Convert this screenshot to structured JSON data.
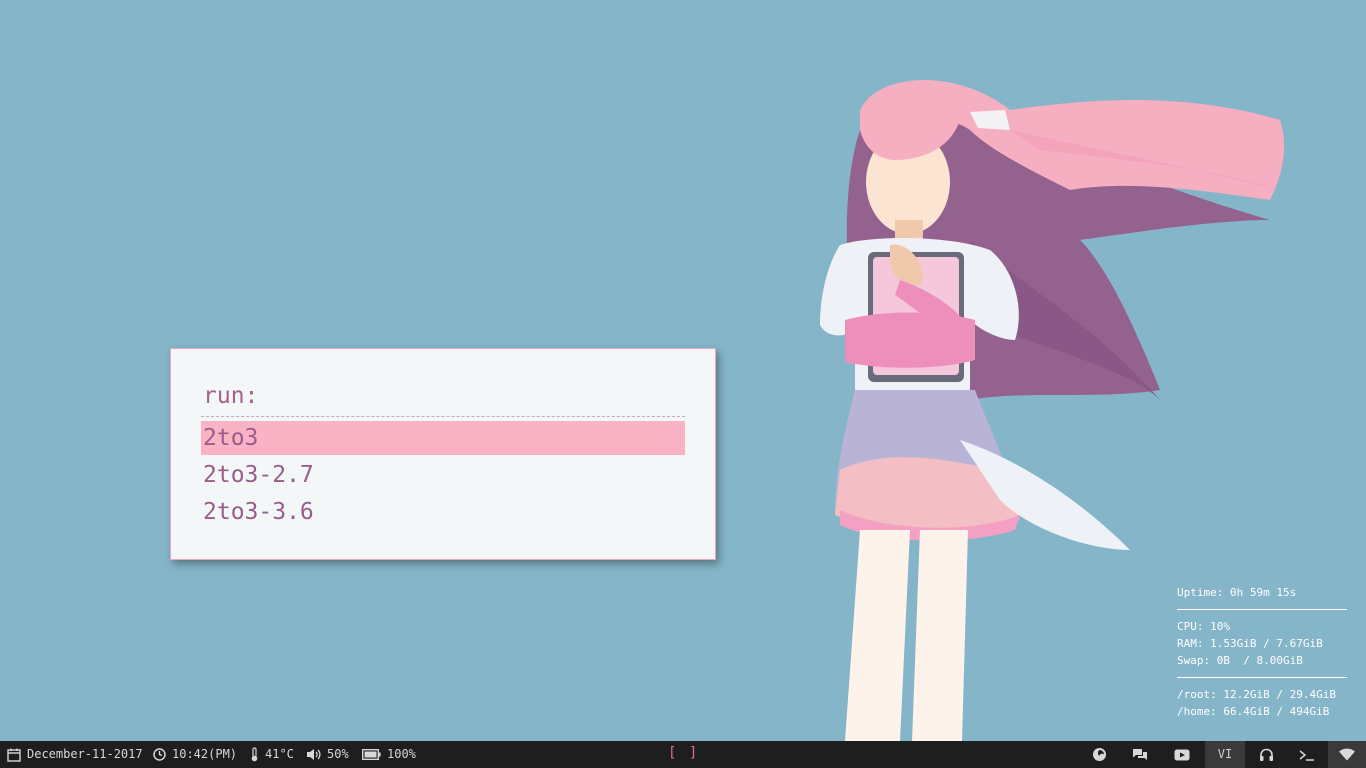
{
  "launcher": {
    "prompt": "run:",
    "results": [
      "2to3",
      "2to3-2.7",
      "2to3-3.6"
    ],
    "selected_index": 0
  },
  "conky": {
    "uptime": "Uptime: 0h 59m 15s",
    "cpu": "CPU: 10%",
    "ram": "RAM: 1.53GiB / 7.67GiB",
    "swap": "Swap: 0B  / 8.00GiB",
    "root": "/root: 12.2GiB / 29.4GiB",
    "home": "/home: 66.4GiB / 494GiB"
  },
  "taskbar": {
    "date": "December-11-2017",
    "time": "10:42(PM)",
    "temperature": "41°C",
    "volume": "50%",
    "battery": "100%",
    "workspace": "[ ]",
    "mode": "VI",
    "icons": [
      "calendar-icon",
      "clock-icon",
      "thermometer-icon",
      "volume-icon",
      "battery-icon",
      "firefox-icon",
      "chat-icon",
      "youtube-icon",
      "headphones-icon",
      "terminal-icon",
      "wifi-icon"
    ]
  },
  "colors": {
    "background": "#85b5c8",
    "accent": "#f9b3c4",
    "text_purple": "#9a5c8a",
    "taskbar": "#1e1e1e"
  }
}
